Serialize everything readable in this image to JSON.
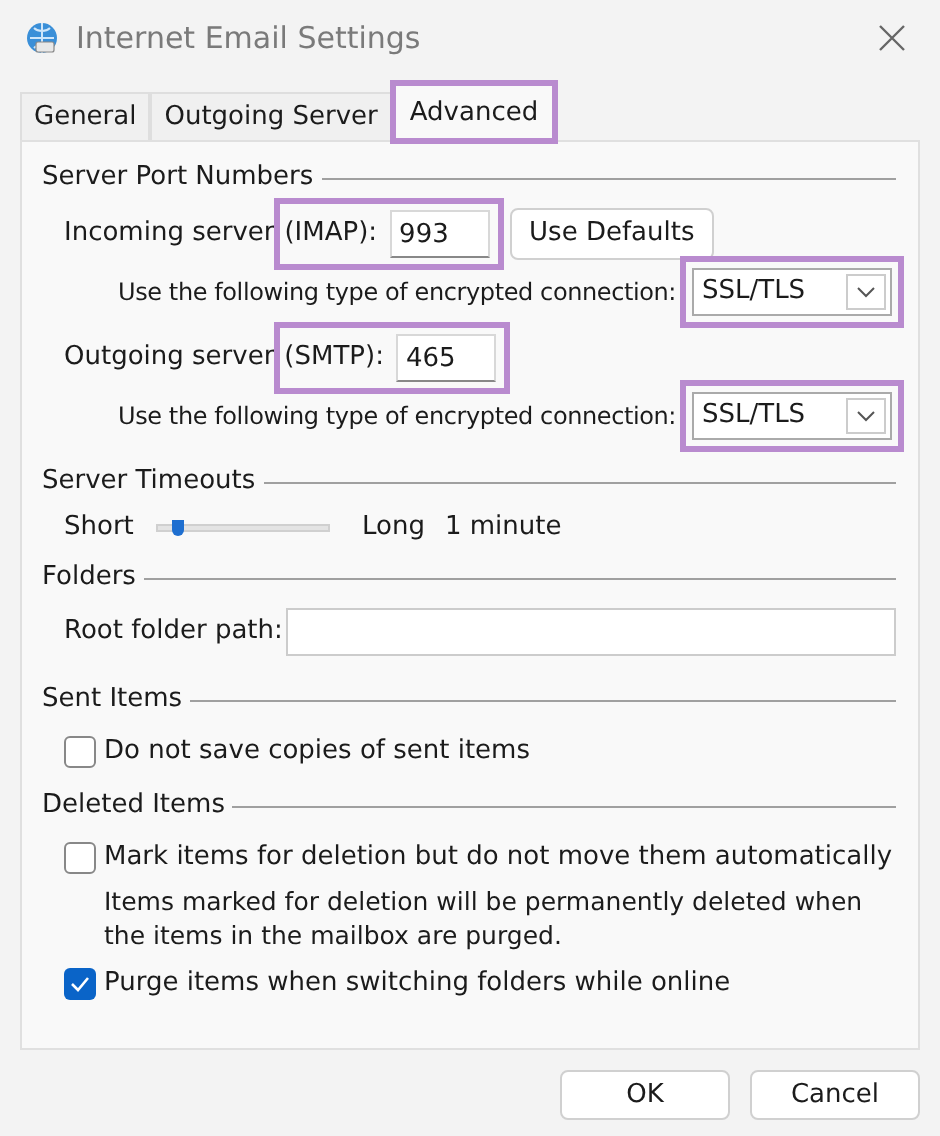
{
  "window": {
    "title": "Internet Email Settings"
  },
  "tabs": [
    {
      "label": "General",
      "selected": false,
      "highlighted": false
    },
    {
      "label": "Outgoing Server",
      "selected": false,
      "highlighted": false
    },
    {
      "label": "Advanced",
      "selected": true,
      "highlighted": true
    }
  ],
  "server_ports": {
    "heading": "Server Port Numbers",
    "incoming": {
      "label": "Incoming server",
      "protocol": "(IMAP):",
      "value": "993",
      "highlighted": true
    },
    "use_defaults_button": "Use Defaults",
    "incoming_encryption": {
      "label": "Use the following type of encrypted connection:",
      "value": "SSL/TLS",
      "highlighted": true
    },
    "outgoing": {
      "label": "Outgoing server",
      "protocol": "(SMTP):",
      "value": "465",
      "highlighted": true
    },
    "outgoing_encryption": {
      "label": "Use the following type of encrypted connection:",
      "value": "SSL/TLS",
      "highlighted": true
    }
  },
  "server_timeouts": {
    "heading": "Server Timeouts",
    "min_label": "Short",
    "level": 0.12,
    "max_label": "Long",
    "reading": "1 minute"
  },
  "folders": {
    "heading": "Folders",
    "root_label": "Root folder path:"
  },
  "sent_items": {
    "heading": "Sent Items",
    "options": [
      {
        "label": "Do not save copies of sent items",
        "checked": false
      }
    ]
  },
  "deleted_items": {
    "heading": "Deleted Items",
    "options": [
      {
        "kind": "checkbox",
        "label": "Mark items for deletion but do not move them automatically",
        "checked": false
      },
      {
        "kind": "note",
        "label": "Items marked for deletion will be permanently deleted when the items in the mailbox are purged."
      },
      {
        "kind": "checkbox",
        "label": "Purge items when switching folders while online",
        "checked": true
      }
    ]
  },
  "buttons": [
    "OK",
    "Cancel"
  ]
}
